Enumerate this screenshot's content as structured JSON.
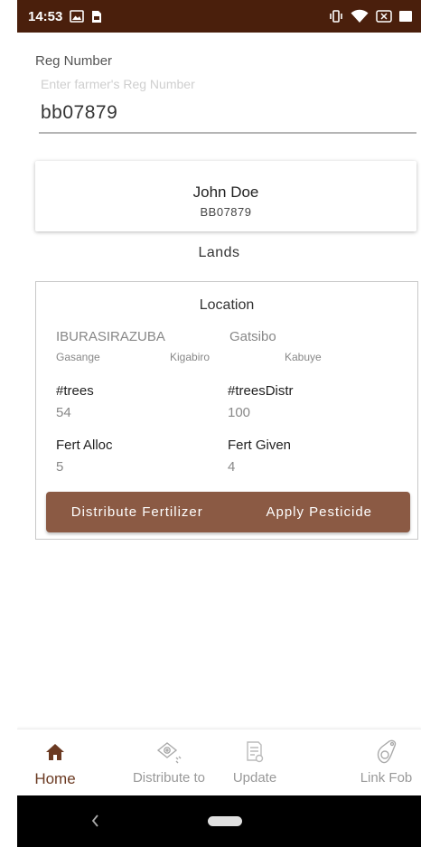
{
  "status_bar": {
    "time": "14:53",
    "icons": [
      "gallery-icon",
      "notification-icon",
      "vibrate-icon",
      "wifi-icon",
      "no-sim-icon",
      "battery-icon"
    ]
  },
  "form": {
    "reg_label": "Reg Number",
    "reg_placeholder": "Enter farmer's Reg Number",
    "reg_value": "bb07879"
  },
  "farmer": {
    "name": "John Doe",
    "reg": "BB07879"
  },
  "lands": {
    "title": "Lands",
    "items": [
      {
        "location_title": "Location",
        "province": "IBURASIRAZUBA",
        "district": "Gatsibo",
        "sector": "Gasange",
        "cell": "Kigabiro",
        "village": "Kabuye",
        "trees_label": "#trees",
        "trees": "54",
        "trees_distr_label": "#treesDistr",
        "trees_distr": "100",
        "fert_alloc_label": "Fert Alloc",
        "fert_alloc": "5",
        "fert_given_label": "Fert Given",
        "fert_given": "4",
        "distribute_label": "Distribute Fertilizer",
        "pesticide_label": "Apply Pesticide"
      }
    ]
  },
  "bottom_nav": {
    "items": [
      {
        "label": "Home",
        "icon": "home-icon",
        "active": true
      },
      {
        "label": "Distribute to",
        "icon": "distribute-icon",
        "active": false
      },
      {
        "label": "Update",
        "icon": "update-icon",
        "active": false
      },
      {
        "label": "Link Fob",
        "icon": "fob-icon",
        "active": false
      }
    ]
  },
  "colors": {
    "status_bar": "#4a1f0c",
    "accent": "#6b3a22",
    "button": "#8b5a44",
    "nav_inactive": "#999999"
  }
}
